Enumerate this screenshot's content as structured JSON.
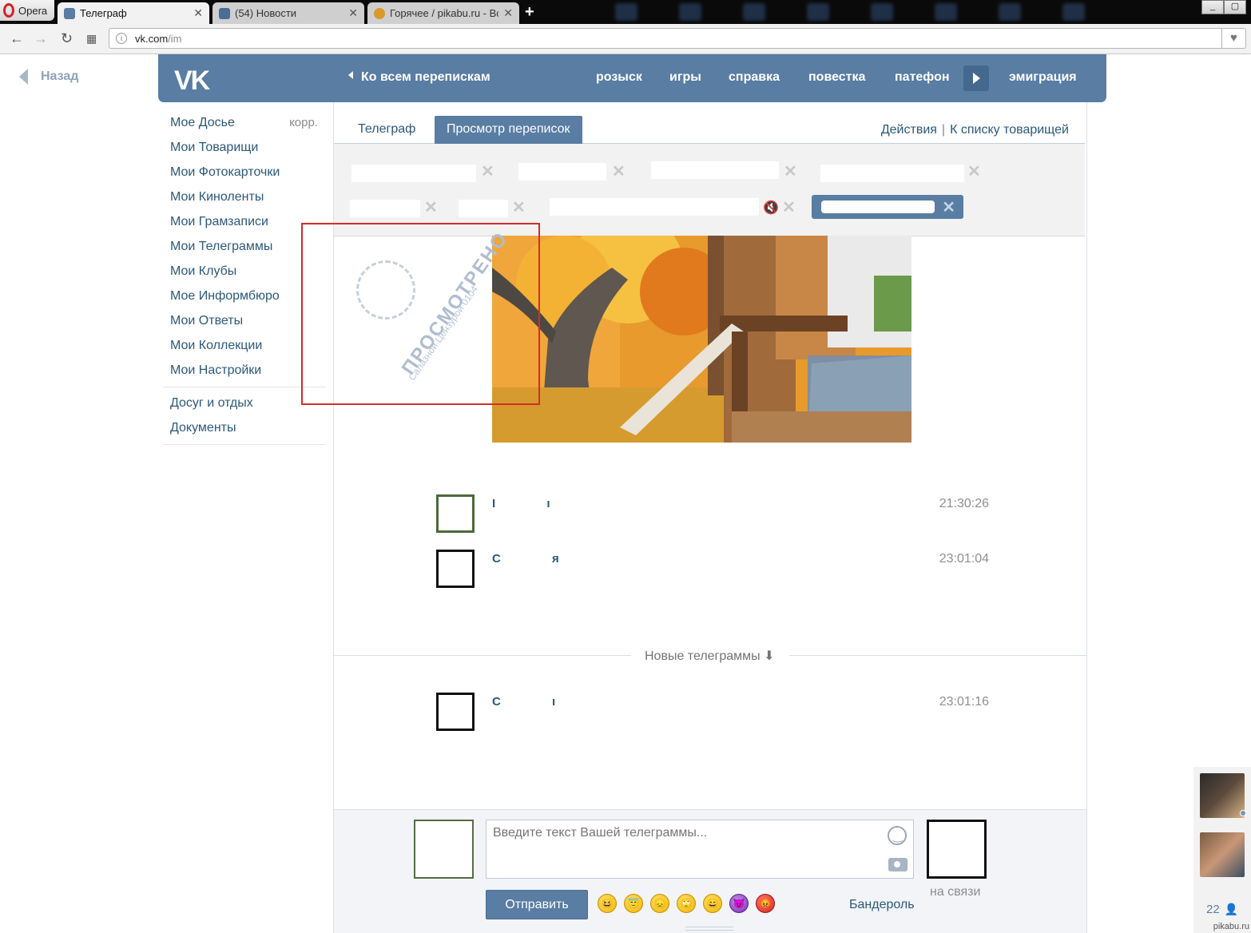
{
  "browser": {
    "menu_label": "Opera",
    "tabs": [
      {
        "title": "Телеграф",
        "active": true
      },
      {
        "title": "(54) Новости",
        "active": false
      },
      {
        "title": "Горячее / pikabu.ru - Все",
        "active": false
      }
    ],
    "address": {
      "host": "vk.com",
      "path": "/im"
    },
    "controls": {
      "min": "_",
      "max": "▢"
    }
  },
  "header": {
    "back_label": "Назад",
    "logo": "VK",
    "to_all": "Ко всем перепискам",
    "nav": [
      "розыск",
      "игры",
      "справка",
      "повестка",
      "патефон",
      "эмиграция"
    ]
  },
  "left_menu": {
    "items": [
      {
        "label": "Мое Досье",
        "extra": "корр."
      },
      {
        "label": "Мои Товарищи"
      },
      {
        "label": "Мои Фотокарточки"
      },
      {
        "label": "Мои Киноленты"
      },
      {
        "label": "Мои Грамзаписи"
      },
      {
        "label": "Мои Телеграммы"
      },
      {
        "label": "Мои Клубы"
      },
      {
        "label": "Мое Информбюро"
      },
      {
        "label": "Мои Ответы"
      },
      {
        "label": "Мои Коллекции"
      },
      {
        "label": "Мои Настройки"
      }
    ],
    "extra_items": [
      {
        "label": "Досуг и отдых"
      },
      {
        "label": "Документы"
      }
    ]
  },
  "main": {
    "tabs": {
      "telegraph": "Телеграф",
      "view": "Просмотр переписок"
    },
    "actions": {
      "actions": "Действия",
      "separator": "|",
      "to_list": "К списку товарищей"
    },
    "stamp": {
      "title": "ПРОСМОТРЕНО",
      "subtitle": "Салазной Цензурой",
      "number": "0104"
    },
    "messages": [
      {
        "name": "I ı",
        "time": "21:30:26"
      },
      {
        "name": "С я",
        "time": "23:01:04"
      },
      {
        "name": "С ı",
        "time": "23:01:16"
      }
    ],
    "new_divider": "Новые телеграммы ⬇"
  },
  "compose": {
    "placeholder": "Введите текст Вашей телеграммы...",
    "send_label": "Отправить",
    "parcel_label": "Бандероль",
    "online_label": "на связи",
    "emojis": [
      "😆",
      "😇",
      "😞",
      "🙄",
      "😄",
      "😈",
      "😡"
    ]
  },
  "sidebar": {
    "count": "22",
    "watermark": "pikabu.ru"
  },
  "colors": {
    "vk_blue": "#597da3",
    "link": "#2b587a",
    "stamp_frame": "#d32c2c"
  }
}
